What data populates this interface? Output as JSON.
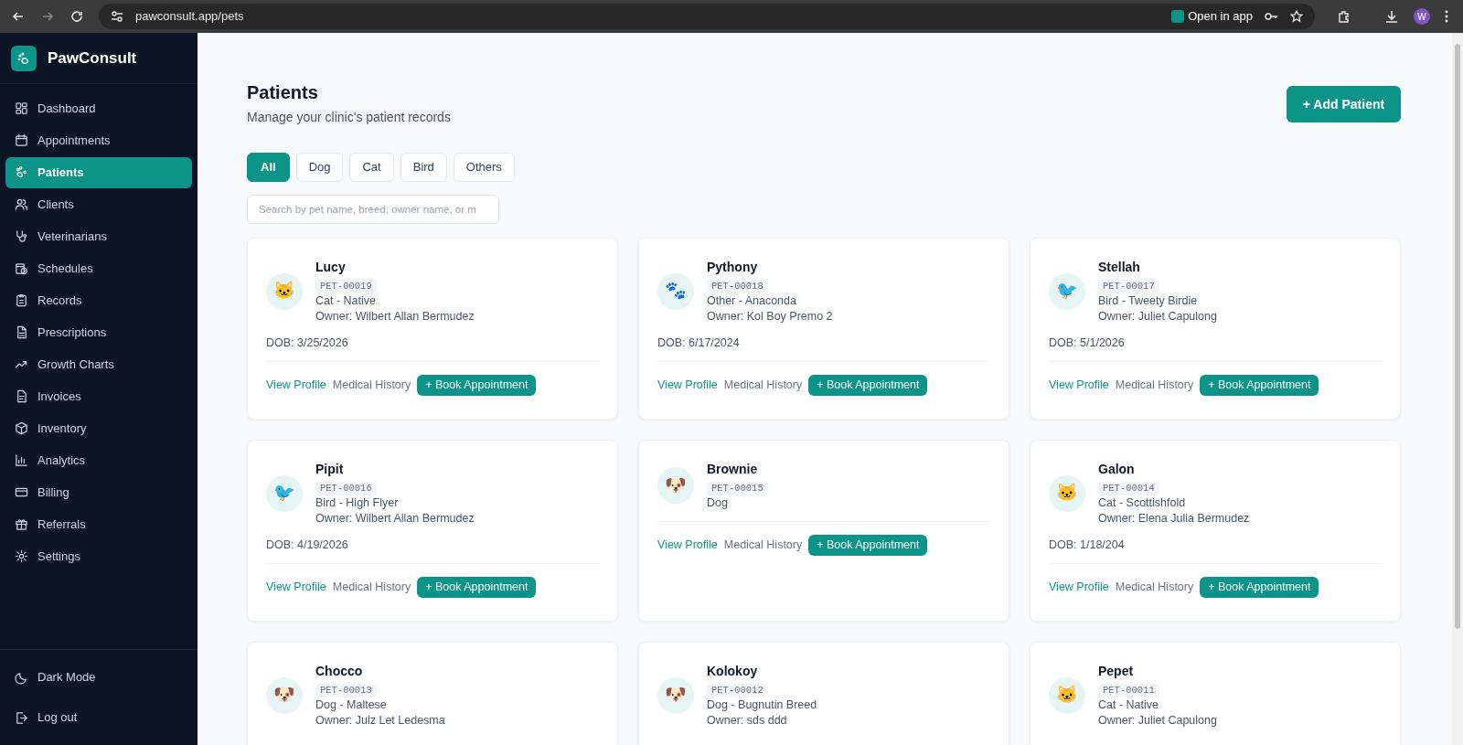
{
  "browser": {
    "url": "pawconsult.app/pets",
    "open_in_app": "Open in app",
    "profile_initial": "W"
  },
  "sidebar": {
    "brand": "PawConsult",
    "items": [
      {
        "label": "Dashboard",
        "selected": false
      },
      {
        "label": "Appointments",
        "selected": false
      },
      {
        "label": "Patients",
        "selected": true
      },
      {
        "label": "Clients",
        "selected": false
      },
      {
        "label": "Veterinarians",
        "selected": false
      },
      {
        "label": "Schedules",
        "selected": false
      },
      {
        "label": "Records",
        "selected": false
      },
      {
        "label": "Prescriptions",
        "selected": false
      },
      {
        "label": "Growth Charts",
        "selected": false
      },
      {
        "label": "Invoices",
        "selected": false
      },
      {
        "label": "Inventory",
        "selected": false
      },
      {
        "label": "Analytics",
        "selected": false
      },
      {
        "label": "Billing",
        "selected": false
      },
      {
        "label": "Referrals",
        "selected": false
      },
      {
        "label": "Settings",
        "selected": false
      }
    ],
    "footer": [
      {
        "label": "Dark Mode"
      },
      {
        "label": "Log out"
      }
    ]
  },
  "header": {
    "title": "Patients",
    "subtitle": "Manage your clinic's patient records",
    "add_button": "+ Add Patient"
  },
  "filters": [
    {
      "label": "All",
      "selected": true
    },
    {
      "label": "Dog",
      "selected": false
    },
    {
      "label": "Cat",
      "selected": false
    },
    {
      "label": "Bird",
      "selected": false
    },
    {
      "label": "Others",
      "selected": false
    }
  ],
  "search": {
    "placeholder": "Search by pet name, breed, owner name, or m"
  },
  "patients": [
    {
      "name": "Lucy",
      "avatar": "🐱",
      "id": "PET-00019",
      "species_breed": "Cat - Native",
      "owner": "Owner: Wilbert Allan Bermudez",
      "dob": "DOB: 3/25/2026",
      "actions": [
        "View Profile",
        "Medical History",
        "+ Book Appointment"
      ]
    },
    {
      "name": "Pythony",
      "avatar": "🐾",
      "id": "PET-00018",
      "species_breed": "Other - Anaconda",
      "owner": "Owner: Kol Boy Premo 2",
      "dob": "DOB: 6/17/2024",
      "actions": [
        "View Profile",
        "Medical History",
        "+ Book Appointment"
      ]
    },
    {
      "name": "Stellah",
      "avatar": "🐦",
      "id": "PET-00017",
      "species_breed": "Bird - Tweety Birdie",
      "owner": "Owner: Juliet Capulong",
      "dob": "DOB: 5/1/2026",
      "actions": [
        "View Profile",
        "Medical History",
        "+ Book Appointment"
      ]
    },
    {
      "name": "Pipit",
      "avatar": "🐦",
      "id": "PET-00016",
      "species_breed": "Bird - High Flyer",
      "owner": "Owner: Wilbert Allan Bermudez",
      "dob": "DOB: 4/19/2026",
      "actions": [
        "View Profile",
        "Medical History",
        "+ Book Appointment"
      ]
    },
    {
      "name": "Brownie",
      "avatar": "🐶",
      "id": "PET-00015",
      "species_breed": "Dog",
      "actions": [
        "View Profile",
        "Medical History",
        "+ Book Appointment"
      ]
    },
    {
      "name": "Galon",
      "avatar": "🐱",
      "id": "PET-00014",
      "species_breed": "Cat - Scottishfold",
      "owner": "Owner: Elena Julia Bermudez",
      "dob": "DOB: 1/18/204",
      "actions": [
        "View Profile",
        "Medical History",
        "+ Book Appointment"
      ]
    },
    {
      "name": "Chocco",
      "avatar": "🐶",
      "id": "PET-00013",
      "species_breed": "Dog - Maltese",
      "owner": "Owner: Julz Let Ledesma"
    },
    {
      "name": "Kolokoy",
      "avatar": "🐶",
      "id": "PET-00012",
      "species_breed": "Dog - Bugnutin Breed",
      "owner": "Owner: sds ddd"
    },
    {
      "name": "Pepet",
      "avatar": "🐱",
      "id": "PET-00011",
      "species_breed": "Cat - Native",
      "owner": "Owner: Juliet Capulong"
    }
  ]
}
